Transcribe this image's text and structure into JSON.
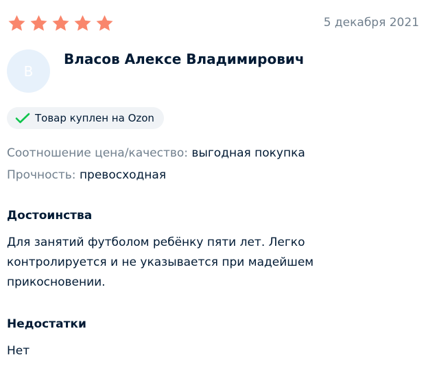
{
  "review": {
    "rating": 5,
    "rating_max": 5,
    "star_color": "#f9866c",
    "date": "5 декабря 2021",
    "author": {
      "initial": "В",
      "name": "Власов Алексе Владимирович"
    },
    "badge": {
      "icon": "check-icon",
      "text": "Товар куплен на Ozon"
    },
    "attributes": [
      {
        "label": "Соотношение цена/качество:",
        "value": "выгодная покупка"
      },
      {
        "label": "Прочность:",
        "value": "превосходная"
      }
    ],
    "pros": {
      "title": "Достоинства",
      "text": "Для занятий футболом ребёнку пяти лет. Легко контролируется и не указывается при мадейшем прикосновении."
    },
    "cons": {
      "title": "Недостатки",
      "text": "Нет"
    }
  }
}
